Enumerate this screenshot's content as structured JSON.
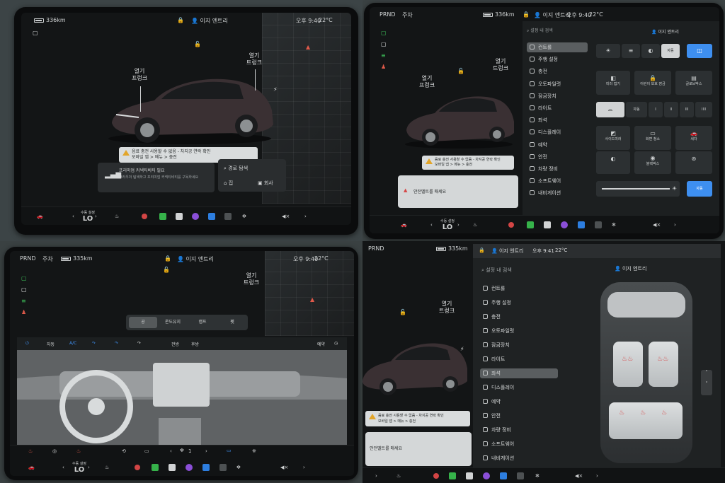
{
  "status": {
    "prnd": "PRND",
    "parking": "주차",
    "range_336": "336km",
    "range_335": "335km",
    "profile_icon": "person-icon",
    "profile": "이지 엔트리",
    "time_940": "오후 9:40",
    "time_941": "오후 9:41",
    "temp": "22°C"
  },
  "car_view": {
    "open_label": "열기",
    "frunk": "프렁크",
    "trunk": "트렁크",
    "warning_line1": "음료 충전 사용할 수 없음 - 차지공 연락 확인",
    "warning_line2": "모바일 앱 > 메뉴 > 충전",
    "wifi_title": "프리미엄 커넥티비티 필요",
    "wifi_desc": "브라우저 탐색하고 프리미엄 커넥티비티를 구독하세요",
    "nav_title": "경로 탐색",
    "home": "집",
    "work": "회사",
    "seatbelt_warning": "안전벨트를 매세요"
  },
  "taskbar": {
    "climate_label": "수동 설정",
    "temp_lo": "LO",
    "fan_level": "1",
    "icons": [
      "car-icon",
      "seat-heat-icon",
      "camera-icon",
      "phone-icon",
      "apps-icon",
      "music-icon",
      "bluetooth-icon",
      "more-icon",
      "fan-icon",
      "volume-mute-icon"
    ]
  },
  "settings": {
    "search_placeholder": "설정 내 검색",
    "menu": [
      {
        "label": "컨트롤",
        "icon": "toggle-icon"
      },
      {
        "label": "주행 설정",
        "icon": "steering-icon"
      },
      {
        "label": "충전",
        "icon": "bolt-icon"
      },
      {
        "label": "오토파일럿",
        "icon": "wheel-icon"
      },
      {
        "label": "잠금장치",
        "icon": "lock-icon"
      },
      {
        "label": "라이트",
        "icon": "light-icon"
      },
      {
        "label": "좌석",
        "icon": "seat-icon"
      },
      {
        "label": "디스플레이",
        "icon": "display-icon"
      },
      {
        "label": "예약",
        "icon": "clock-icon"
      },
      {
        "label": "안전",
        "icon": "shield-icon"
      },
      {
        "label": "차량 정비",
        "icon": "wrench-icon"
      },
      {
        "label": "소프트웨어",
        "icon": "download-icon"
      },
      {
        "label": "내비게이션",
        "icon": "navigation-icon"
      }
    ],
    "controls_labels": {
      "auto": "자동",
      "mirror_fold": "미러 접기",
      "child_lock": "어린이 보호 잠금",
      "glovebox": "글로브박스",
      "wiper_auto": "자동",
      "sentry": "사이드미러",
      "screen_clean": "화면 청소",
      "dashcam": "블랙박스",
      "wash": "세차",
      "brightness": "자동"
    }
  },
  "climate": {
    "tabs": [
      "공",
      "온도유지",
      "캠프",
      "펫"
    ],
    "auto": "자동",
    "ac": "A/C",
    "front": "전방",
    "rear": "후방",
    "schedule": "예약"
  }
}
